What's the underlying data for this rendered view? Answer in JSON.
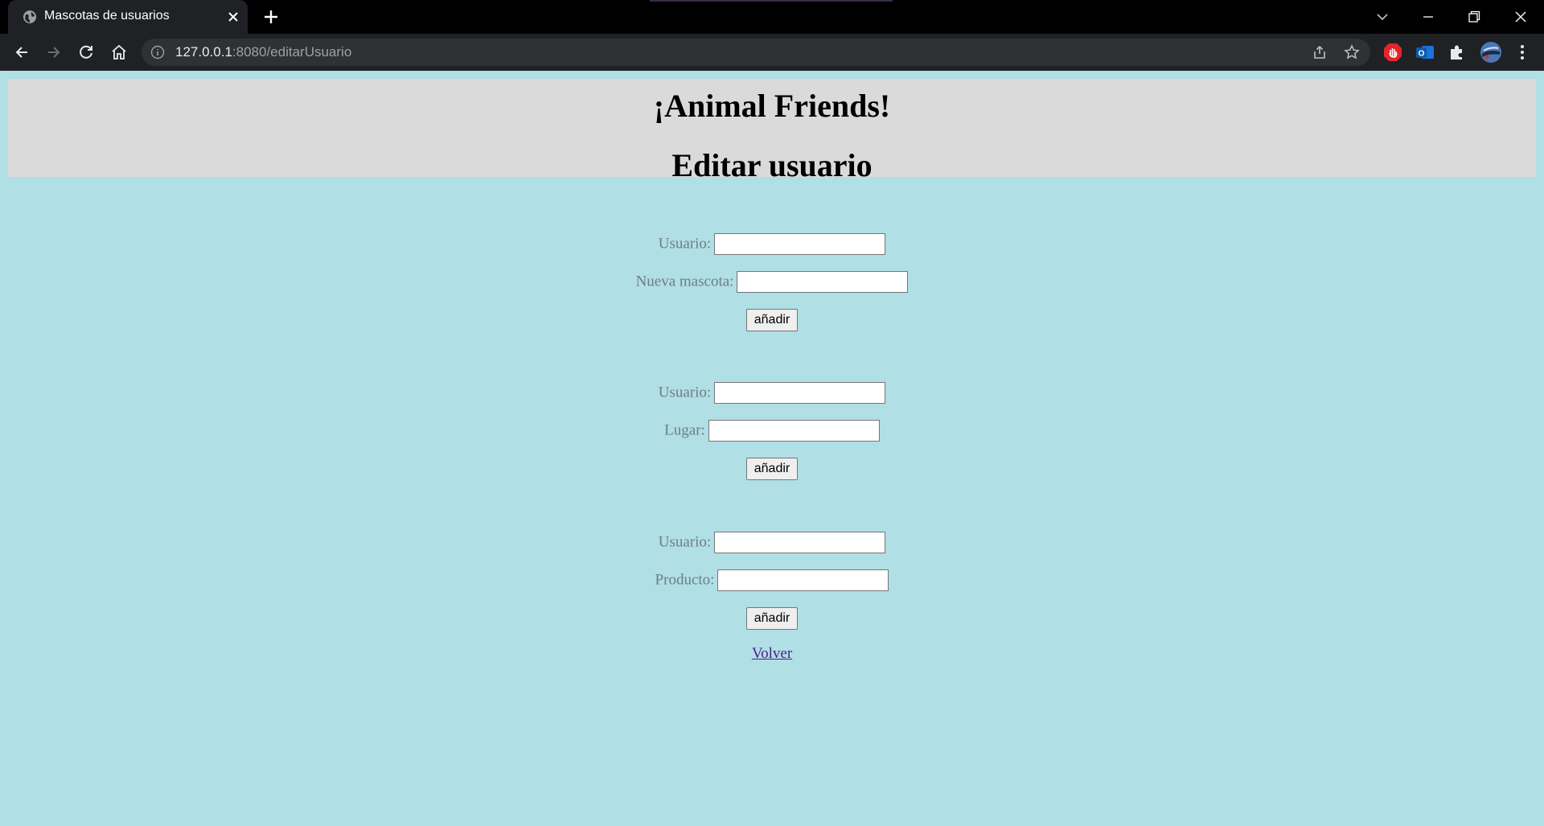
{
  "browser": {
    "tab_title": "Mascotas de usuarios",
    "url_host": "127.0.0.1",
    "url_rest": ":8080/editarUsuario"
  },
  "page": {
    "title": "¡Animal Friends!",
    "subtitle": "Editar usuario",
    "forms": [
      {
        "field1_label": "Usuario:",
        "field2_label": "Nueva mascota:",
        "submit_label": "añadir"
      },
      {
        "field1_label": "Usuario:",
        "field2_label": "Lugar:",
        "submit_label": "añadir"
      },
      {
        "field1_label": "Usuario:",
        "field2_label": "Producto:",
        "submit_label": "añadir"
      }
    ],
    "back_link": "Volver"
  },
  "colors": {
    "page_background": "#b0dfe5",
    "banner_background": "#dadada",
    "label_color": "#6e7e82",
    "link_color": "#551a8b"
  }
}
